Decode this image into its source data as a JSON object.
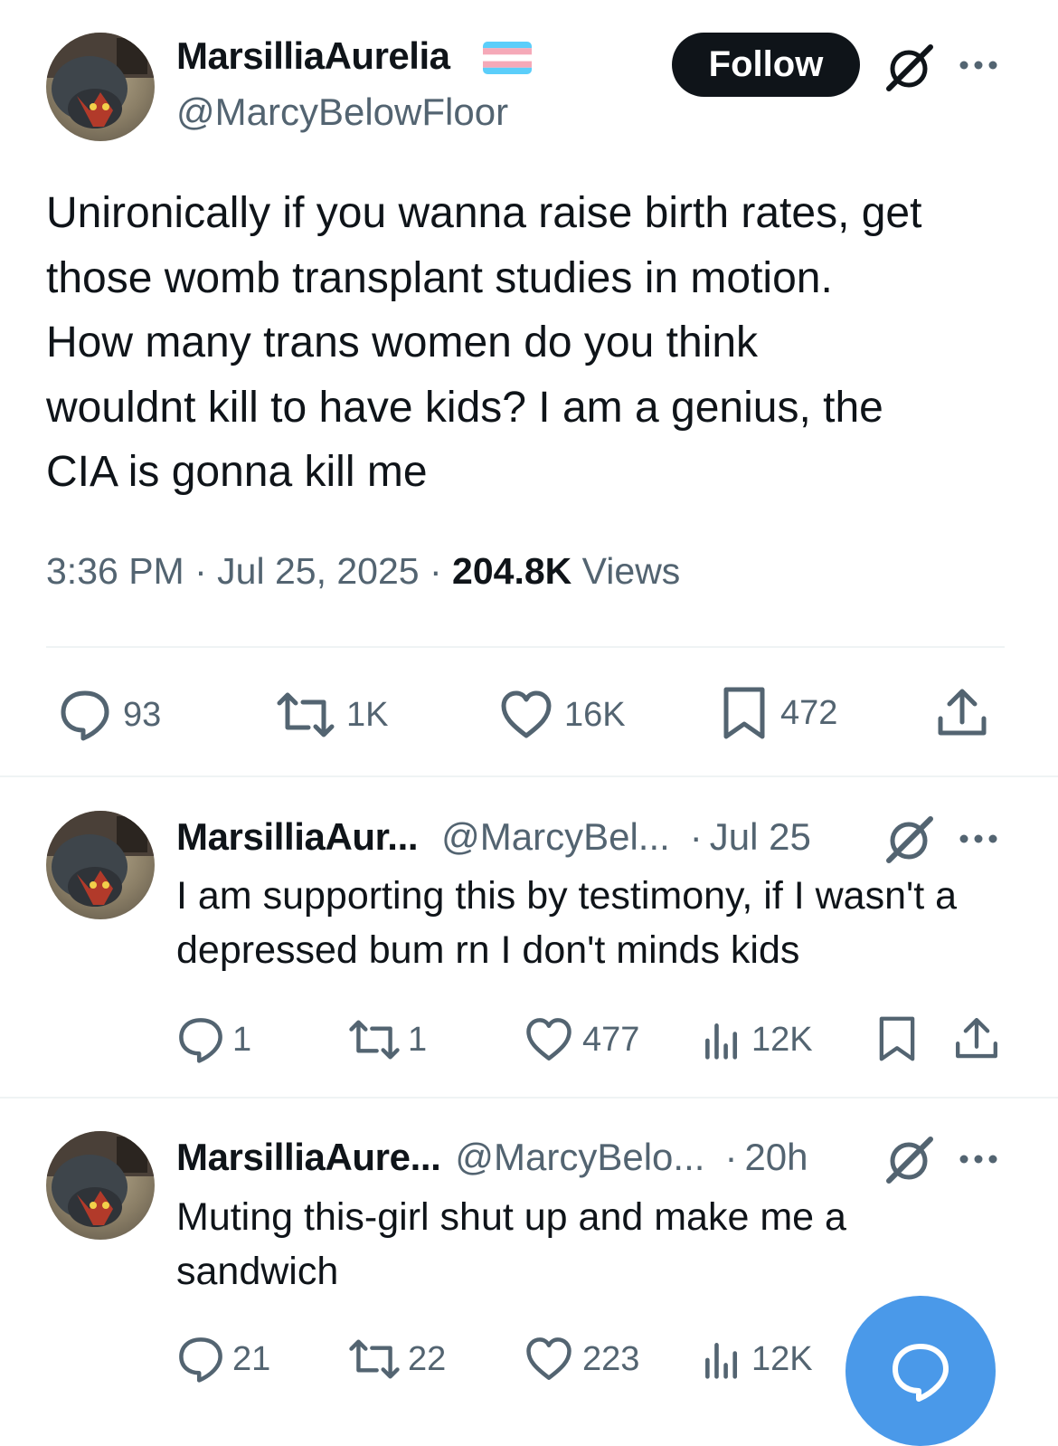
{
  "main_tweet": {
    "display_name": "MarsilliaAurelia",
    "handle": "@MarcyBelowFloor",
    "follow_label": "Follow",
    "text": "Unironically if you wanna raise birth rates, get\nthose womb transplant studies in motion.\nHow many trans women do you think\nwouldnt kill to have kids? I am a genius, the\nCIA is gonna kill me",
    "time": "3:36 PM",
    "date": "Jul 25, 2025",
    "views_count": "204.8K",
    "views_label": "Views",
    "replies": "93",
    "reposts": "1K",
    "likes": "16K",
    "bookmarks": "472"
  },
  "replies": [
    {
      "display_name": "MarsilliaAur...",
      "handle": "@MarcyBel...",
      "time": "Jul 25",
      "text": "I am supporting this by testimony,  if I wasn't a depressed bum rn I don't minds kids",
      "replies": "1",
      "reposts": "1",
      "likes": "477",
      "views": "12K"
    },
    {
      "display_name": "MarsilliaAure...",
      "handle": "@MarcyBelo...",
      "time": "20h",
      "text": "Muting this-girl shut up and make me a sandwich",
      "replies": "21",
      "reposts": "22",
      "likes": "223",
      "views": "12K"
    }
  ],
  "separator": "·",
  "icons": {
    "grok": "grok-icon",
    "more": "more-options-icon",
    "reply": "reply-icon",
    "repost": "repost-icon",
    "like": "heart-icon",
    "bookmark": "bookmark-icon",
    "share": "share-icon",
    "views": "analytics-icon",
    "compose": "compose-reply-icon"
  },
  "colors": {
    "text": "#0f1419",
    "secondary": "#536471",
    "follow_bg": "#0f1419",
    "fab": "#4a99e9",
    "flag_blue": "#5bcefa",
    "flag_pink": "#f5a9b8",
    "flag_white": "#ffffff"
  }
}
